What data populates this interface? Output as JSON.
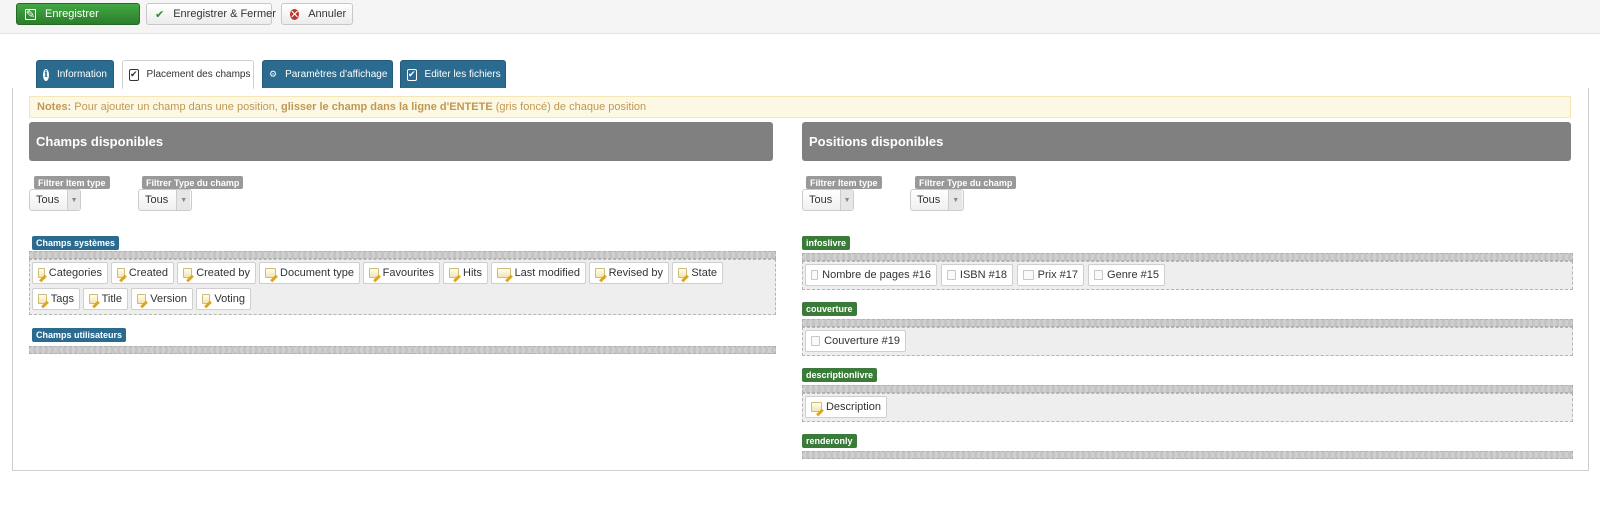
{
  "toolbar": {
    "save_label": "Enregistrer",
    "save_close_label": "Enregistrer & Fermer",
    "cancel_label": "Annuler"
  },
  "tabs": [
    {
      "label": "Information",
      "icon": "info-icon",
      "active": false
    },
    {
      "label": "Placement des champs",
      "icon": "clipboard-icon",
      "active": true
    },
    {
      "label": "Paramètres d'affichage",
      "icon": "gear-icon",
      "active": false
    },
    {
      "label": "Editer les fichiers",
      "icon": "clipboard-icon",
      "active": false
    }
  ],
  "notes": {
    "prefix": "Notes:",
    "text_1": " Pour ajouter un champ dans une position, ",
    "bold": "glisser le champ dans la ligne d'ENTETE",
    "text_2": " (gris foncé) de chaque position"
  },
  "left_panel": {
    "title": "Champs disponibles",
    "filter_item_type_label": "Filtrer Item type",
    "filter_item_type_value": "Tous",
    "filter_field_type_label": "Filtrer Type du champ",
    "filter_field_type_value": "Tous",
    "system_group_label": "Champs systèmes",
    "system_fields": [
      "Categories",
      "Created",
      "Created by",
      "Document type",
      "Favourites",
      "Hits",
      "Last modified",
      "Revised by",
      "State",
      "Tags",
      "Title",
      "Version",
      "Voting"
    ],
    "user_group_label": "Champs utilisateurs"
  },
  "right_panel": {
    "title": "Positions disponibles",
    "filter_item_type_label": "Filtrer Item type",
    "filter_item_type_value": "Tous",
    "filter_field_type_label": "Filtrer Type du champ",
    "filter_field_type_value": "Tous",
    "positions": [
      {
        "name": "infoslivre",
        "fields": [
          "Nombre de pages #16",
          "ISBN #18",
          "Prix #17",
          "Genre #15"
        ]
      },
      {
        "name": "couverture",
        "fields": [
          "Couverture #19"
        ]
      },
      {
        "name": "descriptionlivre",
        "fields": [
          "Description"
        ]
      },
      {
        "name": "renderonly",
        "fields": []
      }
    ]
  },
  "colors": {
    "save_green": "#2f8a2f",
    "tab_blue": "#2b6b8f",
    "panel_grey": "#808080",
    "group_green": "#3a7b3a",
    "notes_bg": "#fcf8e3",
    "notes_text": "#c09853"
  }
}
